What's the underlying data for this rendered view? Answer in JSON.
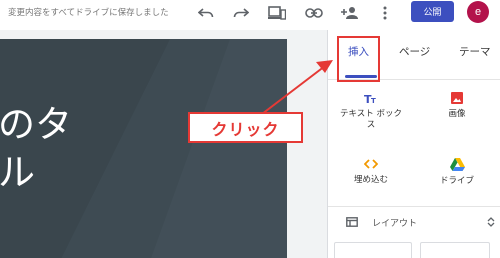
{
  "topbar": {
    "save_status": "変更内容をすべてドライブに保存しました",
    "publish_label": "公開",
    "avatar_letter": "e"
  },
  "slide": {
    "title_line1": "のタ",
    "title_line2": "ル"
  },
  "panel": {
    "tabs": [
      {
        "label": "挿入"
      },
      {
        "label": "ページ"
      },
      {
        "label": "テーマ"
      }
    ],
    "insert_items": [
      {
        "label": "テキスト ボック\nス",
        "icon": "text-box-icon"
      },
      {
        "label": "画像",
        "icon": "image-icon"
      },
      {
        "label": "埋め込む",
        "icon": "embed-icon"
      },
      {
        "label": "ドライブ",
        "icon": "drive-icon"
      }
    ],
    "layout_label": "レイアウト"
  },
  "callout": {
    "text": "クリック"
  },
  "colors": {
    "accent": "#3c4fbf",
    "avatar": "#b3124b",
    "callout_red": "#e53935",
    "slide_bg": "#3a464d"
  }
}
